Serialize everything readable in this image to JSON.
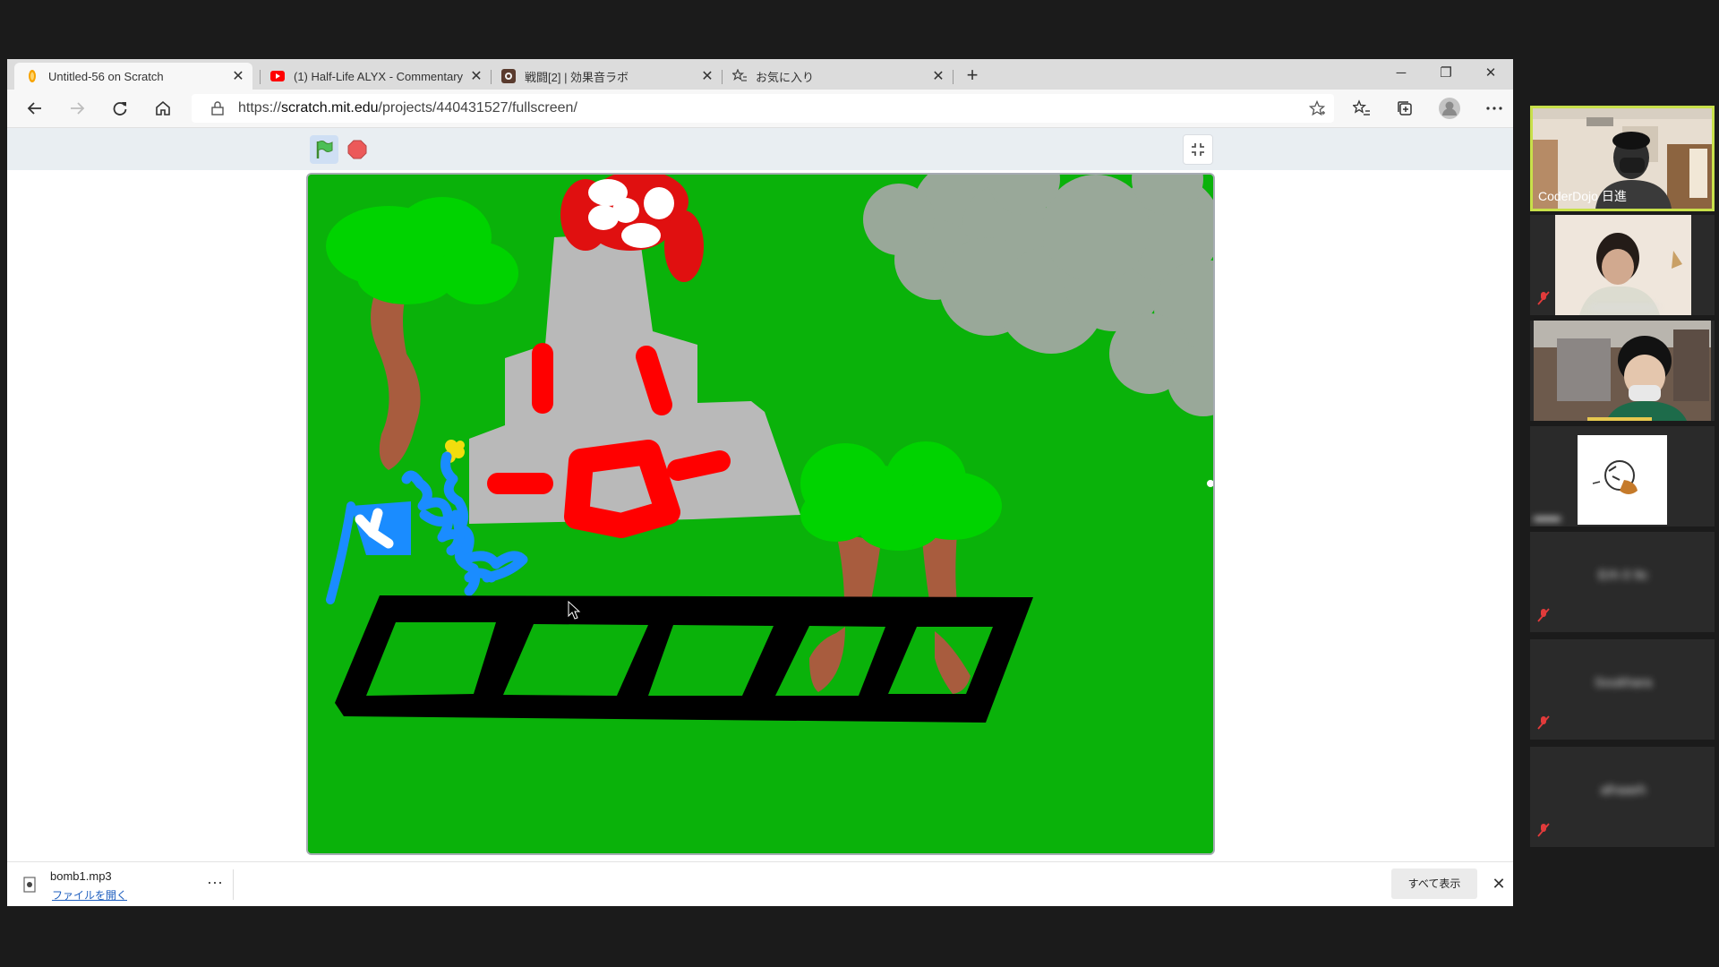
{
  "browser": {
    "tabs": [
      {
        "label": "Untitled-56 on Scratch",
        "icon": "scratch-icon",
        "active": true
      },
      {
        "label": "(1) Half-Life ALYX - Commentary",
        "icon": "youtube-icon",
        "active": false
      },
      {
        "label": "戦闘[2] | 効果音ラボ",
        "icon": "soundlab-icon",
        "active": false
      },
      {
        "label": "お気に入り",
        "icon": "favorites-icon",
        "active": false
      }
    ],
    "url_prefix": "https://",
    "url_domain": "scratch.mit.edu",
    "url_path": "/projects/440431527/fullscreen/"
  },
  "downloads": {
    "file": "bomb1.mp3",
    "open_label": "ファイルを開く",
    "show_all": "すべて表示"
  },
  "zoom": {
    "participants": [
      {
        "name": "CoderDojo 日進",
        "active": true
      },
      {
        "name": "",
        "active": false
      },
      {
        "name": "",
        "active": false
      },
      {
        "name": "",
        "active": false
      },
      {
        "name": "Erh 0 9c",
        "active": false
      },
      {
        "name": "Soukhara",
        "active": false
      },
      {
        "name": "afraaeh",
        "active": false
      }
    ]
  },
  "colors": {
    "stage_green": "#0ab20a",
    "tree_green": "#00d300",
    "trunk_brown": "#a85c3e",
    "castle_gray": "#b9b9b9",
    "paint_red": "#ff0000",
    "cloud_gray": "#99a899",
    "active_speaker": "#c8e04a",
    "link_blue": "#1f5fbf"
  }
}
